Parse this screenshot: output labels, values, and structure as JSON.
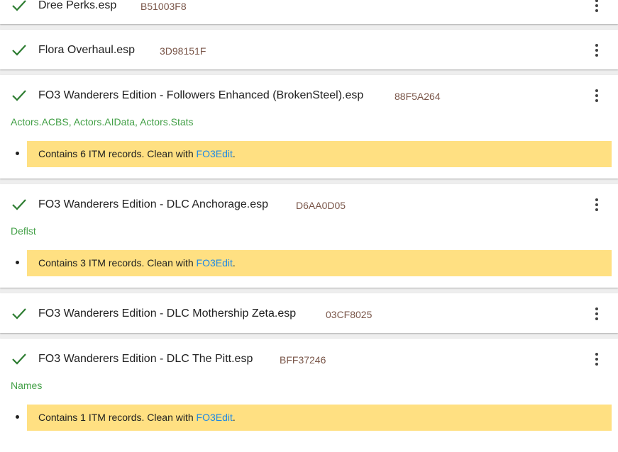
{
  "plugins": [
    {
      "name": "Dree Perks.esp",
      "crc": "B51003F8"
    },
    {
      "name": "Flora Overhaul.esp",
      "crc": "3D98151F"
    },
    {
      "name": "FO3 Wanderers Edition - Followers Enhanced (BrokenSteel).esp",
      "crc": "88F5A264",
      "tags": "Actors.ACBS, Actors.AIData, Actors.Stats",
      "message": {
        "text": "Contains 6 ITM records. Clean with ",
        "link": "FO3Edit",
        "suffix": "."
      }
    },
    {
      "name": "FO3 Wanderers Edition - DLC Anchorage.esp",
      "crc": "D6AA0D05",
      "tags": "Deflst",
      "message": {
        "text": "Contains 3 ITM records. Clean with ",
        "link": "FO3Edit",
        "suffix": "."
      }
    },
    {
      "name": "FO3 Wanderers Edition - DLC Mothership Zeta.esp",
      "crc": "03CF8025"
    },
    {
      "name": "FO3 Wanderers Edition - DLC The Pitt.esp",
      "crc": "BFF37246",
      "tags": "Names",
      "message": {
        "text": "Contains 1 ITM records. Clean with ",
        "link": "FO3Edit",
        "suffix": "."
      }
    }
  ],
  "icons": {
    "status": "check-icon",
    "menu": "more-vert-icon"
  },
  "colors": {
    "check": "#2e7d32",
    "crc": "#795548",
    "tags": "#43a047",
    "message_bg": "#ffe082",
    "link": "#1e88e5"
  }
}
